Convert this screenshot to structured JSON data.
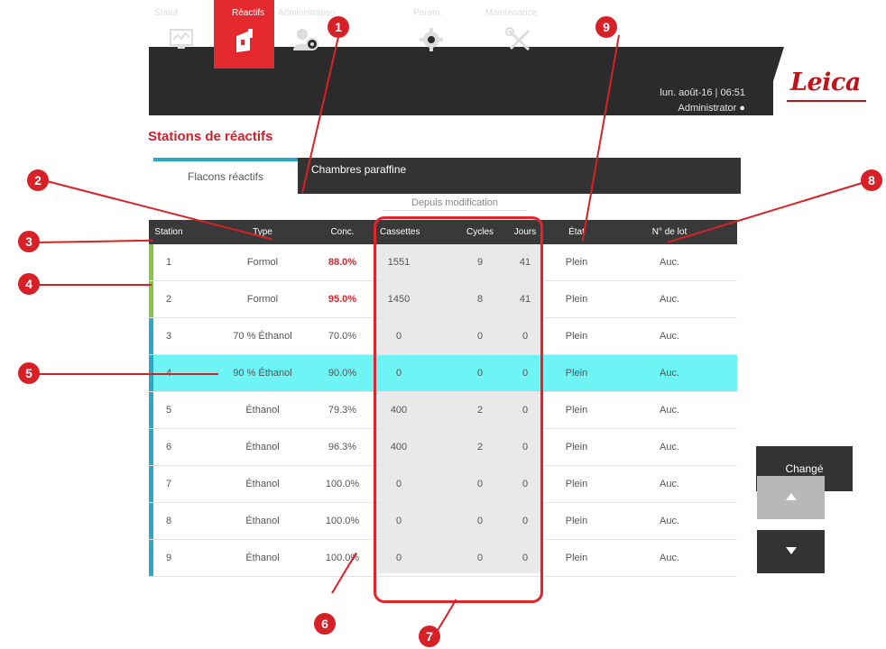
{
  "nav": {
    "items": [
      {
        "label": "Statut",
        "icon": "monitor-icon"
      },
      {
        "label": "Réactifs",
        "icon": "reagent-bottle-icon"
      },
      {
        "label": "Administration",
        "icon": "user-gear-icon"
      },
      {
        "label": "Param.",
        "icon": "gear-icon"
      },
      {
        "label": "Maintenance",
        "icon": "tools-icon"
      }
    ],
    "datetime": "lun. août-16 | 06:51",
    "user": "Administrator",
    "brand": "Leica"
  },
  "page": {
    "title": "Stations de réactifs"
  },
  "tabs": {
    "active": "Flacons réactifs",
    "inactive": "Chambres paraffine"
  },
  "subheader": "Depuis modification",
  "table": {
    "columns": [
      "Station",
      "Type",
      "Conc.",
      "Cassettes",
      "Cycles",
      "Jours",
      "État",
      "N° de lot"
    ],
    "rows": [
      {
        "station": "1",
        "type": "Formol",
        "conc": "88.0%",
        "cassettes": "1551",
        "cycles": "9",
        "jours": "41",
        "etat": "Plein",
        "lot": "Auc."
      },
      {
        "station": "2",
        "type": "Formol",
        "conc": "95.0%",
        "cassettes": "1450",
        "cycles": "8",
        "jours": "41",
        "etat": "Plein",
        "lot": "Auc."
      },
      {
        "station": "3",
        "type": "70 % Éthanol",
        "conc": "70.0%",
        "cassettes": "0",
        "cycles": "0",
        "jours": "0",
        "etat": "Plein",
        "lot": "Auc."
      },
      {
        "station": "4",
        "type": "90 % Éthanol",
        "conc": "90.0%",
        "cassettes": "0",
        "cycles": "0",
        "jours": "0",
        "etat": "Plein",
        "lot": "Auc."
      },
      {
        "station": "5",
        "type": "Éthanol",
        "conc": "79.3%",
        "cassettes": "400",
        "cycles": "2",
        "jours": "0",
        "etat": "Plein",
        "lot": "Auc."
      },
      {
        "station": "6",
        "type": "Éthanol",
        "conc": "96.3%",
        "cassettes": "400",
        "cycles": "2",
        "jours": "0",
        "etat": "Plein",
        "lot": "Auc."
      },
      {
        "station": "7",
        "type": "Éthanol",
        "conc": "100.0%",
        "cassettes": "0",
        "cycles": "0",
        "jours": "0",
        "etat": "Plein",
        "lot": "Auc."
      },
      {
        "station": "8",
        "type": "Éthanol",
        "conc": "100.0%",
        "cassettes": "0",
        "cycles": "0",
        "jours": "0",
        "etat": "Plein",
        "lot": "Auc."
      },
      {
        "station": "9",
        "type": "Éthanol",
        "conc": "100.0%",
        "cassettes": "0",
        "cycles": "0",
        "jours": "0",
        "etat": "Plein",
        "lot": "Auc."
      }
    ]
  },
  "buttons": {
    "change": "Changé"
  },
  "callouts": [
    "1",
    "2",
    "3",
    "4",
    "5",
    "6",
    "7",
    "8",
    "9"
  ],
  "colors": {
    "accent_red": "#e52a2f",
    "selected_row": "#6ef4f4",
    "row_bar_blue": "#29a8c8",
    "row_bar_green": "#8cc63f",
    "nav_dark": "#2b2b2b"
  }
}
